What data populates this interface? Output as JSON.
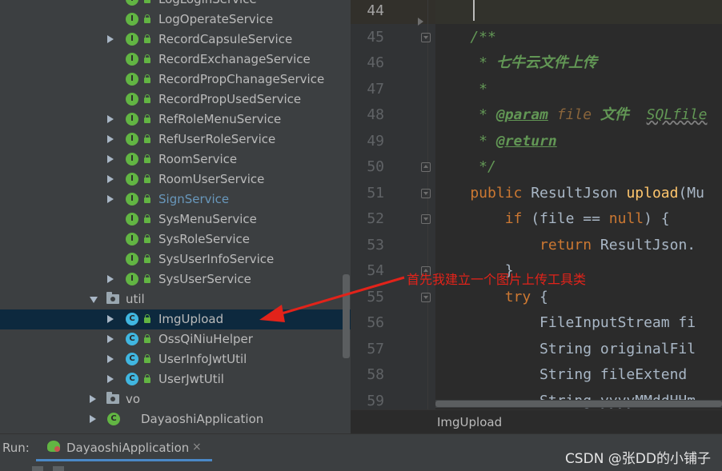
{
  "project_tree": {
    "items": [
      {
        "label": "LogLoginService",
        "kind": "interface",
        "expandable": false,
        "vcs": false
      },
      {
        "label": "LogOperateService",
        "kind": "interface",
        "expandable": false,
        "vcs": false
      },
      {
        "label": "RecordCapsuleService",
        "kind": "interface",
        "expandable": true,
        "vcs": false
      },
      {
        "label": "RecordExchanageService",
        "kind": "interface",
        "expandable": false,
        "vcs": false
      },
      {
        "label": "RecordPropChanageService",
        "kind": "interface",
        "expandable": false,
        "vcs": false
      },
      {
        "label": "RecordPropUsedService",
        "kind": "interface",
        "expandable": false,
        "vcs": false
      },
      {
        "label": "RefRoleMenuService",
        "kind": "interface",
        "expandable": true,
        "vcs": false
      },
      {
        "label": "RefUserRoleService",
        "kind": "interface",
        "expandable": true,
        "vcs": false
      },
      {
        "label": "RoomService",
        "kind": "interface",
        "expandable": true,
        "vcs": false
      },
      {
        "label": "RoomUserService",
        "kind": "interface",
        "expandable": true,
        "vcs": false
      },
      {
        "label": "SignService",
        "kind": "interface",
        "expandable": true,
        "vcs": true
      },
      {
        "label": "SysMenuService",
        "kind": "interface",
        "expandable": false,
        "vcs": false
      },
      {
        "label": "SysRoleService",
        "kind": "interface",
        "expandable": false,
        "vcs": false
      },
      {
        "label": "SysUserInfoService",
        "kind": "interface",
        "expandable": false,
        "vcs": false
      },
      {
        "label": "SysUserService",
        "kind": "interface",
        "expandable": true,
        "vcs": false
      },
      {
        "label": "util",
        "kind": "folder",
        "expanded": true
      },
      {
        "label": "ImgUpload",
        "kind": "class",
        "expandable": true,
        "selected": true
      },
      {
        "label": "OssQiNiuHelper",
        "kind": "class",
        "expandable": true
      },
      {
        "label": "UserInfoJwtUtil",
        "kind": "class",
        "expandable": true
      },
      {
        "label": "UserJwtUtil",
        "kind": "class",
        "expandable": true
      },
      {
        "label": "vo",
        "kind": "folder",
        "expanded": false
      },
      {
        "label": "DayaoshiApplication",
        "kind": "app",
        "expandable": true
      }
    ]
  },
  "editor": {
    "lines": [
      {
        "n": "44",
        "current": true,
        "tokens": []
      },
      {
        "n": "45",
        "fold": "down",
        "tokens": [
          {
            "t": "    /**",
            "c": "doc"
          }
        ]
      },
      {
        "n": "46",
        "tokens": [
          {
            "t": "     * ",
            "c": "doc"
          },
          {
            "t": "七牛云文件上传",
            "c": "docb"
          }
        ]
      },
      {
        "n": "47",
        "tokens": [
          {
            "t": "     *",
            "c": "doc"
          }
        ]
      },
      {
        "n": "48",
        "tokens": [
          {
            "t": "     * ",
            "c": "doc"
          },
          {
            "t": "@param",
            "c": "tag"
          },
          {
            "t": " ",
            "c": "doc"
          },
          {
            "t": "file",
            "c": "param"
          },
          {
            "t": " ",
            "c": "doc"
          },
          {
            "t": "文件",
            "c": "docb"
          },
          {
            "t": "  ",
            "c": "doc"
          },
          {
            "t": "SQLfile",
            "c": "sq"
          }
        ]
      },
      {
        "n": "49",
        "tokens": [
          {
            "t": "     * ",
            "c": "doc"
          },
          {
            "t": "@return",
            "c": "tag"
          }
        ]
      },
      {
        "n": "50",
        "fold": "up",
        "tokens": [
          {
            "t": "     */",
            "c": "doc"
          }
        ]
      },
      {
        "n": "51",
        "fold": "down",
        "tokens": [
          {
            "t": "    public ",
            "c": "kw"
          },
          {
            "t": "ResultJson ",
            "c": "plain"
          },
          {
            "t": "upload",
            "c": "fn"
          },
          {
            "t": "(Mu",
            "c": "plain"
          }
        ]
      },
      {
        "n": "52",
        "fold": "down",
        "tokens": [
          {
            "t": "        if ",
            "c": "kw"
          },
          {
            "t": "(file == ",
            "c": "plain"
          },
          {
            "t": "null",
            "c": "kw"
          },
          {
            "t": ") {",
            "c": "plain"
          }
        ]
      },
      {
        "n": "53",
        "tokens": [
          {
            "t": "            return ",
            "c": "kw"
          },
          {
            "t": "ResultJson.",
            "c": "plain"
          }
        ]
      },
      {
        "n": "54",
        "fold": "up",
        "tokens": [
          {
            "t": "        }",
            "c": "plain"
          }
        ]
      },
      {
        "n": "55",
        "fold": "down",
        "tokens": [
          {
            "t": "        try ",
            "c": "kw"
          },
          {
            "t": "{",
            "c": "plain"
          }
        ]
      },
      {
        "n": "56",
        "tokens": [
          {
            "t": "            FileInputStream fi",
            "c": "plain"
          }
        ]
      },
      {
        "n": "57",
        "tokens": [
          {
            "t": "            String originalFil",
            "c": "plain"
          }
        ]
      },
      {
        "n": "58",
        "tokens": [
          {
            "t": "            String fileExtend ",
            "c": "plain"
          }
        ]
      },
      {
        "n": "59",
        "tokens": [
          {
            "t": "            String yyyyMMddHHm",
            "c": "plain"
          }
        ]
      }
    ],
    "breadcrumb": "ImgUpload"
  },
  "run_bar": {
    "label": "Run:",
    "tab_label": "DayaoshiApplication",
    "tab_close": "×"
  },
  "annotation": {
    "text": "首先我建立一个图片上传工具类",
    "color": "#e2231a"
  },
  "watermark": "CSDN @张DD的小铺子"
}
